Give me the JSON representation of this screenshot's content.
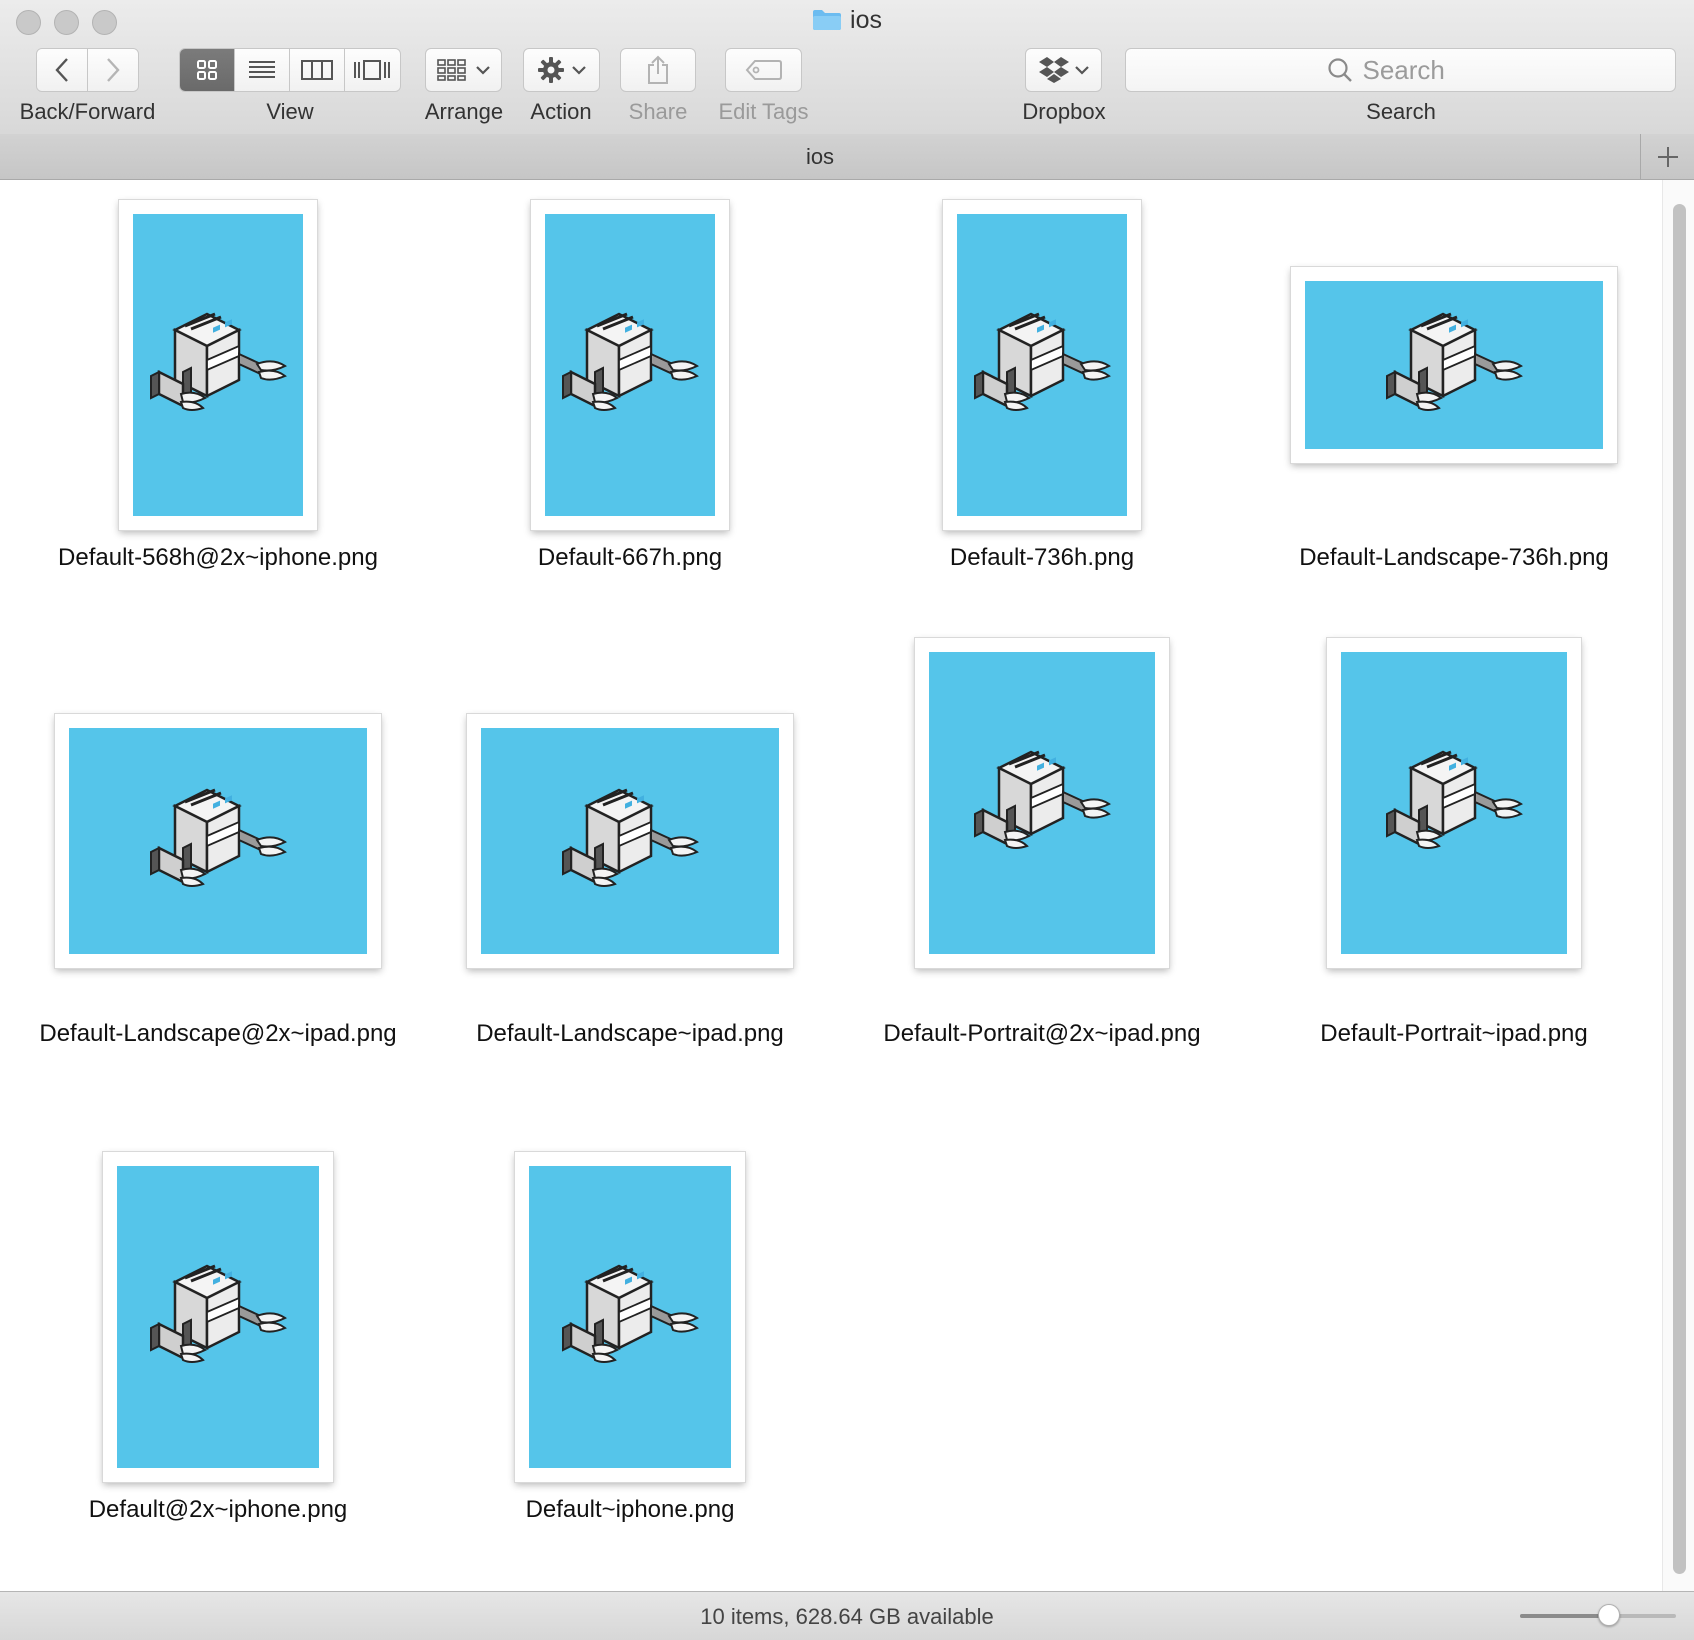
{
  "window": {
    "title": "ios",
    "folder_color": "#6cbcf0"
  },
  "toolbar": {
    "back_forward_label": "Back/Forward",
    "view_label": "View",
    "arrange_label": "Arrange",
    "action_label": "Action",
    "share_label": "Share",
    "edit_tags_label": "Edit Tags",
    "dropbox_label": "Dropbox",
    "search_label": "Search",
    "search_placeholder": "Search",
    "active_view": "icon",
    "view_modes": [
      "icon",
      "list",
      "column",
      "cover-flow"
    ]
  },
  "tab": {
    "title": "ios",
    "add_tab_icon": "plus-icon"
  },
  "files": [
    {
      "name": "Default-568h@2x~iphone.png",
      "orientation": "portrait"
    },
    {
      "name": "Default-667h.png",
      "orientation": "portrait"
    },
    {
      "name": "Default-736h.png",
      "orientation": "portrait"
    },
    {
      "name": "Default-Landscape-736h.png",
      "orientation": "landscape"
    },
    {
      "name": "Default-Landscape@2x~ipad.png",
      "orientation": "landscape"
    },
    {
      "name": "Default-Landscape~ipad.png",
      "orientation": "landscape"
    },
    {
      "name": "Default-Portrait@2x~ipad.png",
      "orientation": "portrait"
    },
    {
      "name": "Default-Portrait~ipad.png",
      "orientation": "portrait"
    },
    {
      "name": "Default@2x~iphone.png",
      "orientation": "portrait"
    },
    {
      "name": "Default~iphone.png",
      "orientation": "portrait"
    }
  ],
  "thumbnail_color": "#55c5ea",
  "status": {
    "text": "10 items, 628.64 GB available",
    "icon_size_level": 0.57
  }
}
